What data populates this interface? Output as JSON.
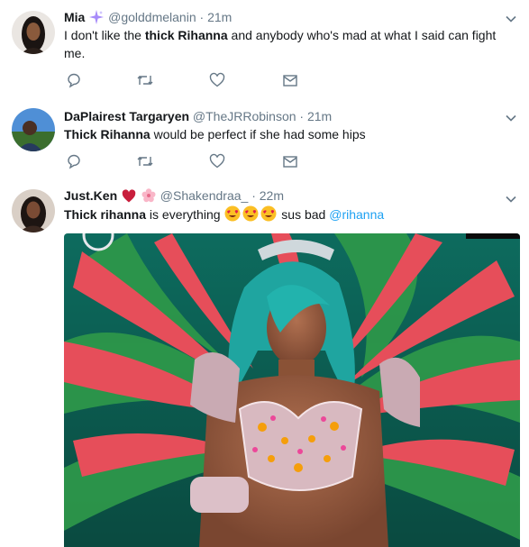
{
  "tweets": [
    {
      "name": "Mia",
      "handle": "@golddmelanin",
      "separator": "·",
      "time": "21m",
      "text_prefix": "I don't like the ",
      "text_bold": "thick Rihanna",
      "text_suffix": " and anybody who's mad at what I said can fight me.",
      "name_icon": "sparkle-icon"
    },
    {
      "name": "DaPlairest Targaryen",
      "handle": "@TheJRRobinson",
      "separator": "·",
      "time": "21m",
      "text_bold": "Thick Rihanna",
      "text_suffix": " would be perfect if she had some hips"
    },
    {
      "name": "Just.Ken",
      "handle": "@Shakendraa_",
      "separator": "·",
      "time": "22m",
      "text_bold": "Thick rihanna",
      "text_mid": " is everything ",
      "text_after_emoji": " sus bad ",
      "mention": "@rihanna",
      "name_icons": [
        "heart-icon",
        "blossom-icon"
      ],
      "emoji": [
        "heart-eyes-face-icon",
        "heart-eyes-face-icon",
        "heart-eyes-face-icon"
      ]
    }
  ],
  "actions": [
    "reply-icon",
    "retweet-icon",
    "like-icon",
    "direct-message-icon"
  ],
  "colors": {
    "text": "#14171a",
    "secondary": "#657786",
    "link": "#1da1f2",
    "divider": "#e6ecf0",
    "sparkle": "#a78bfa",
    "heart": "#c81e3c"
  }
}
